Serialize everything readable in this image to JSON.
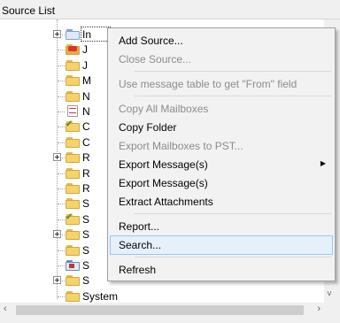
{
  "panel": {
    "title": "Source List"
  },
  "tree": {
    "nodes": [
      {
        "label": "In",
        "icon": "folder-sync-icon",
        "expander": true,
        "selected": true
      },
      {
        "label": "J",
        "icon": "folder-special-icon",
        "expander": false
      },
      {
        "label": "J",
        "icon": "folder-icon",
        "expander": false
      },
      {
        "label": "M",
        "icon": "folder-icon",
        "expander": false
      },
      {
        "label": "N",
        "icon": "folder-icon",
        "expander": false
      },
      {
        "label": "N",
        "icon": "notes-icon",
        "expander": false
      },
      {
        "label": "C",
        "icon": "folder-check-icon",
        "expander": false
      },
      {
        "label": "C",
        "icon": "folder-icon",
        "expander": false
      },
      {
        "label": "R",
        "icon": "folder-icon",
        "expander": true
      },
      {
        "label": "R",
        "icon": "folder-icon",
        "expander": false
      },
      {
        "label": "R",
        "icon": "folder-icon",
        "expander": false
      },
      {
        "label": "S",
        "icon": "folder-icon",
        "expander": false
      },
      {
        "label": "S",
        "icon": "folder-check-icon",
        "expander": false
      },
      {
        "label": "S",
        "icon": "folder-icon",
        "expander": true
      },
      {
        "label": "S",
        "icon": "folder-icon",
        "expander": false
      },
      {
        "label": "S",
        "icon": "search-folder-icon",
        "expander": false
      },
      {
        "label": "S",
        "icon": "folder-icon",
        "expander": true
      },
      {
        "label": "System",
        "icon": "folder-icon",
        "expander": false
      }
    ]
  },
  "context_menu": {
    "items": [
      {
        "label": "Add Source...",
        "enabled": true
      },
      {
        "label": "Close Source...",
        "enabled": false
      },
      {
        "separator": true
      },
      {
        "label": "Use message table to get \"From\" field",
        "enabled": false
      },
      {
        "separator": true
      },
      {
        "label": "Copy All Mailboxes",
        "enabled": false
      },
      {
        "label": "Copy Folder",
        "enabled": true
      },
      {
        "label": "Export Mailboxes to PST...",
        "enabled": false
      },
      {
        "label": "Export Message(s)",
        "enabled": true,
        "submenu": true
      },
      {
        "label": "Export Message(s)",
        "enabled": true
      },
      {
        "label": "Extract Attachments",
        "enabled": true
      },
      {
        "separator": true
      },
      {
        "label": "Report...",
        "enabled": true
      },
      {
        "label": "Search...",
        "enabled": true,
        "highlighted": true
      },
      {
        "separator": true
      },
      {
        "label": "Refresh",
        "enabled": true
      }
    ]
  },
  "colors": {
    "menu_background": "#f2f2f2",
    "highlight": "#e5f0fb",
    "highlight_border": "#99c8f5",
    "disabled_text": "#8c8c8c",
    "folder": "#f5d36c"
  },
  "scrollbars": {
    "vertical_arrow_down": "˅",
    "horizontal_arrow_left": "‹",
    "horizontal_arrow_right": "›"
  }
}
